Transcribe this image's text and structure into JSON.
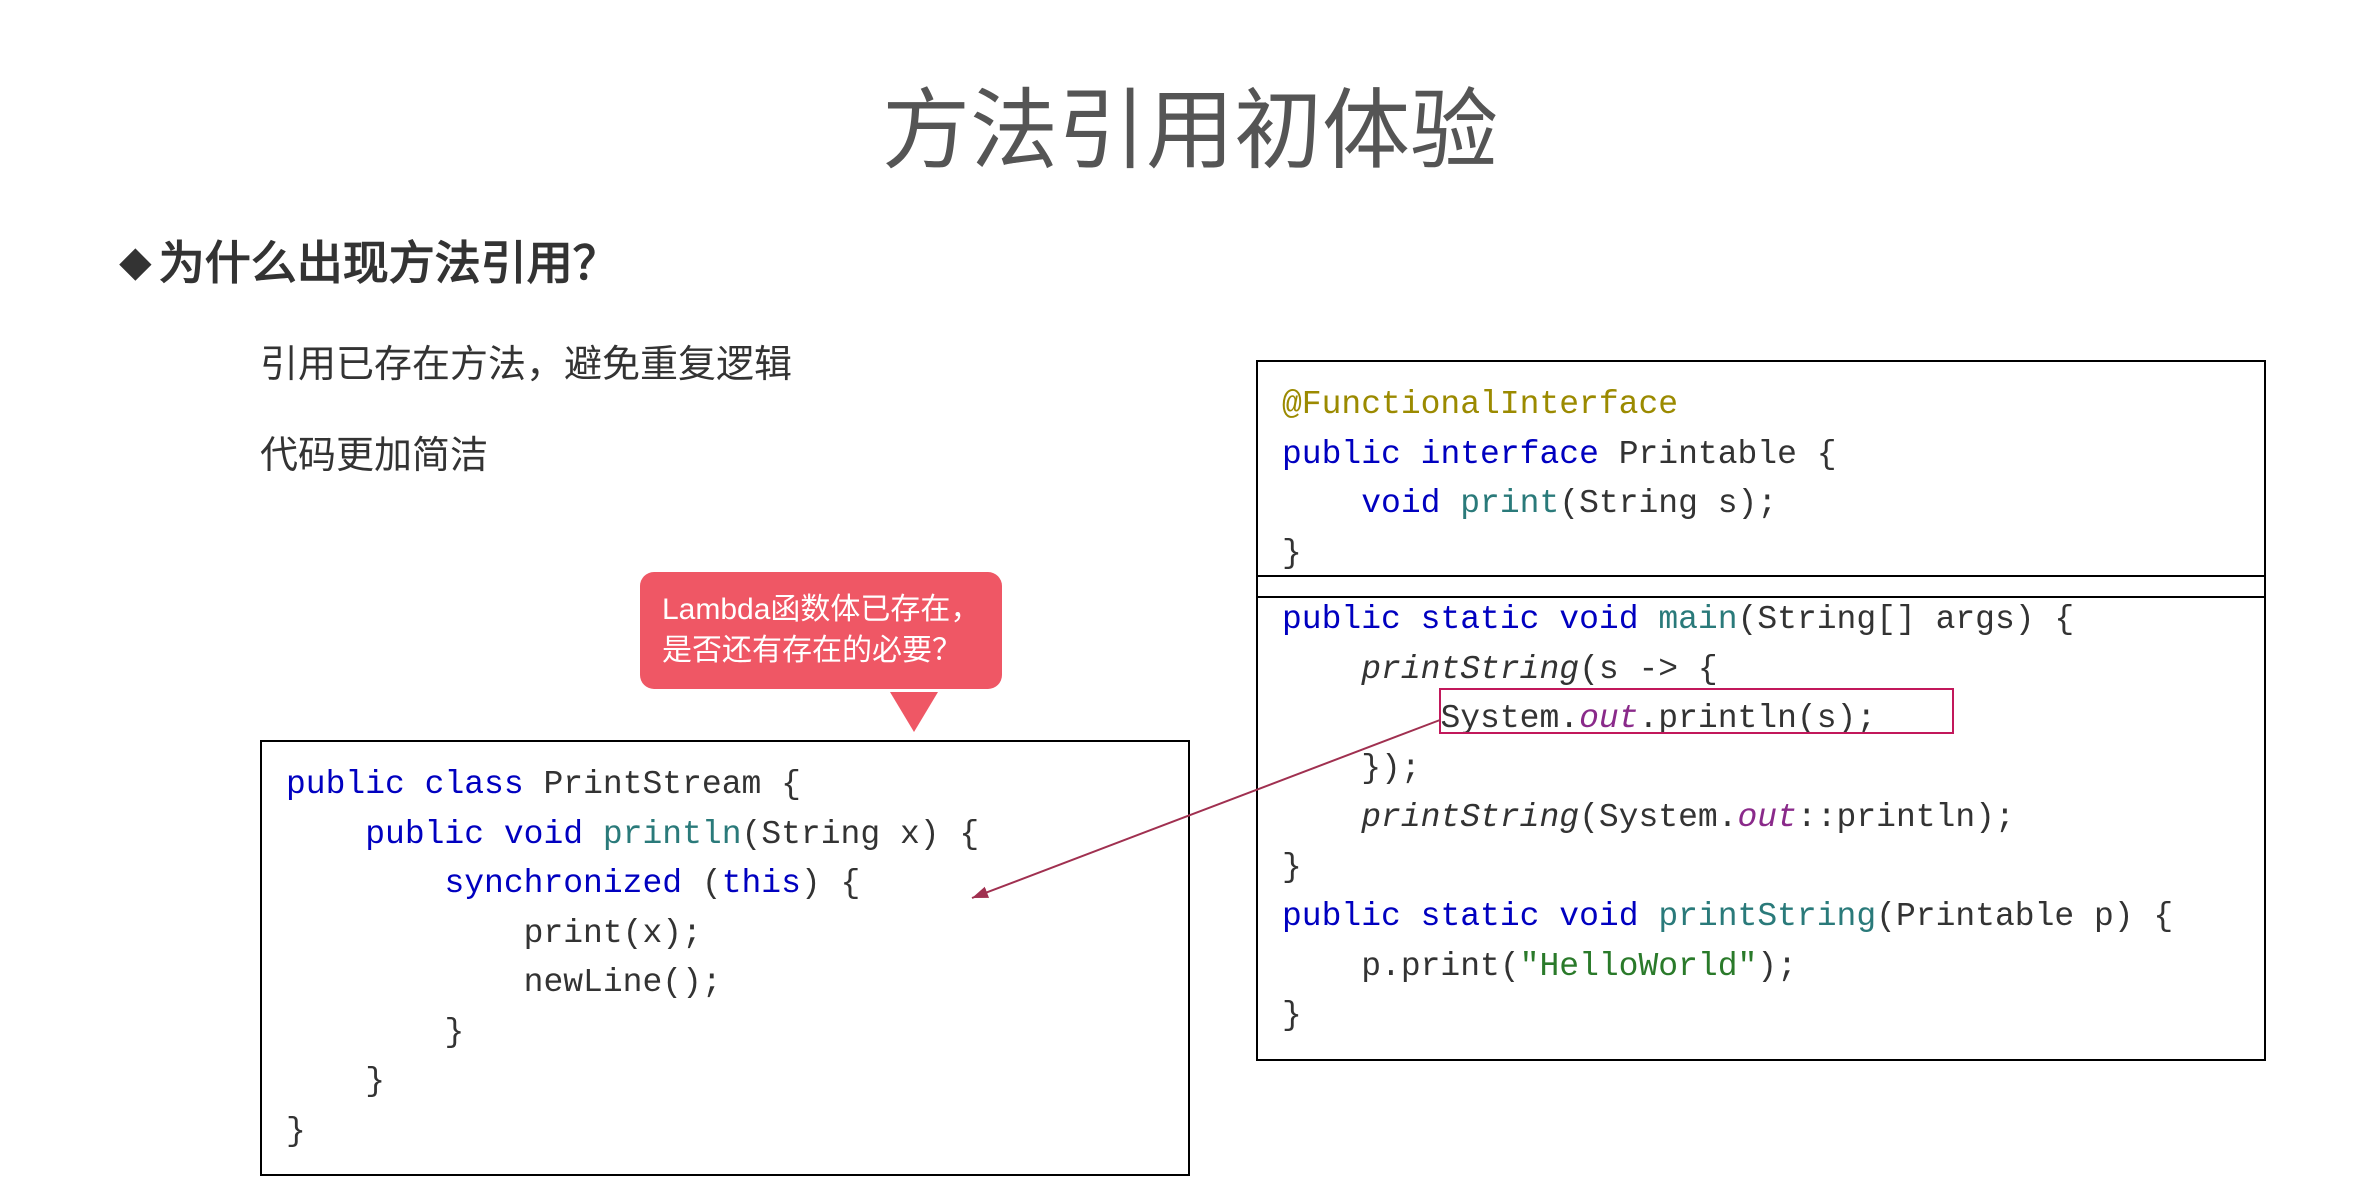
{
  "title": "方法引用初体验",
  "subhead": "为什么出现方法引用？",
  "bullets": {
    "b1": "引用已存在方法，避免重复逻辑",
    "b2": "代码更加简洁"
  },
  "callout": {
    "line1": "Lambda函数体已存在，",
    "line2": "是否还有存在的必要？"
  },
  "code_left": {
    "t0": "public",
    "t1": "class",
    "t2": "PrintStream {",
    "t3": "public",
    "t4": "void",
    "t5": "println",
    "t6": "(String x) {",
    "t7": "synchronized",
    "t8": "(",
    "t9": "this",
    "t10": ") {",
    "t11": "print(x);",
    "t12": "newLine();",
    "t13": "}",
    "t14": "}",
    "t15": "}"
  },
  "code_rt": {
    "t0": "@FunctionalInterface",
    "t1": "public",
    "t2": "interface",
    "t3": "Printable {",
    "t4": "void",
    "t5": "print",
    "t6": "(String s);",
    "t7": "}"
  },
  "code_rb": {
    "t0": "public",
    "t1": "static",
    "t2": "void",
    "t3": "main",
    "t4": "(String[] args) {",
    "t5": "printString",
    "t6": "(s -> {",
    "t7": "System.",
    "t8": "out",
    "t9": ".println(s);",
    "t10": "});",
    "t11": "printString",
    "t12": "(System.",
    "t13": "out",
    "t14": "::println);",
    "t15": "}",
    "t16": "public",
    "t17": "static",
    "t18": "void",
    "t19": "printString",
    "t20": "(Printable p) {",
    "t21": "p.print(",
    "t22": "\"HelloWorld\"",
    "t23": ");",
    "t24": "}"
  }
}
